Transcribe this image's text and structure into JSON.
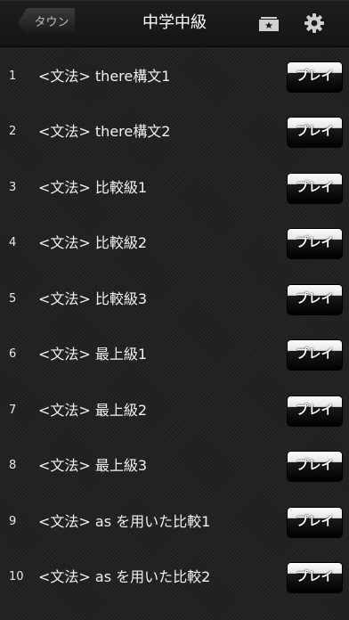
{
  "header": {
    "back_label": "タウン",
    "title": "中学中級",
    "icons": [
      "folder-star-icon",
      "gear-icon"
    ]
  },
  "lessons": [
    {
      "num": "1",
      "title": "<文法> there構文1",
      "button": "プレイ"
    },
    {
      "num": "2",
      "title": "<文法> there構文2",
      "button": "プレイ"
    },
    {
      "num": "3",
      "title": "<文法> 比較級1",
      "button": "プレイ"
    },
    {
      "num": "4",
      "title": "<文法> 比較級2",
      "button": "プレイ"
    },
    {
      "num": "5",
      "title": "<文法> 比較級3",
      "button": "プレイ"
    },
    {
      "num": "6",
      "title": "<文法> 最上級1",
      "button": "プレイ"
    },
    {
      "num": "7",
      "title": "<文法> 最上級2",
      "button": "プレイ"
    },
    {
      "num": "8",
      "title": "<文法> 最上級3",
      "button": "プレイ"
    },
    {
      "num": "9",
      "title": "<文法> as を用いた比較1",
      "button": "プレイ"
    },
    {
      "num": "10",
      "title": "<文法> as を用いた比較2",
      "button": "プレイ"
    }
  ]
}
